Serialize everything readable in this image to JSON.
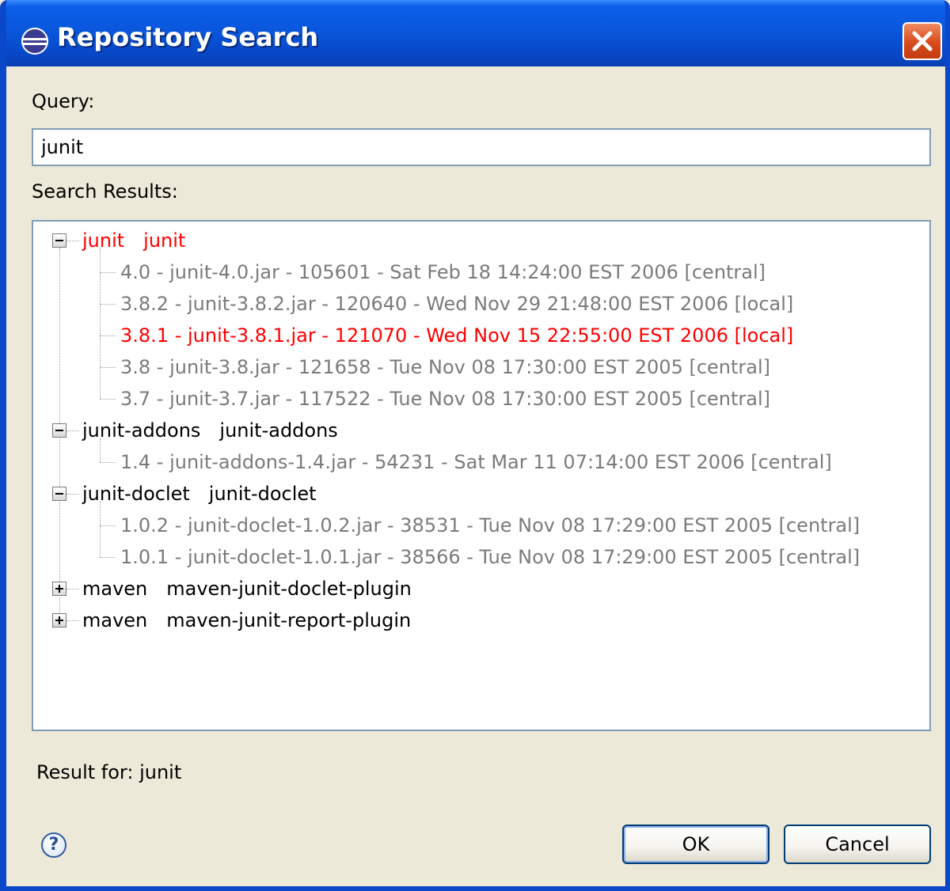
{
  "window": {
    "title": "Repository Search"
  },
  "query": {
    "label": "Query:",
    "value": "junit"
  },
  "results": {
    "label": "Search Results:",
    "groups": [
      {
        "group": "junit",
        "artifact": "junit",
        "expanded": true,
        "highlight": true,
        "items": [
          {
            "text": "4.0 - junit-4.0.jar - 105601 - Sat Feb 18 14:24:00 EST 2006 [central]",
            "highlight": false
          },
          {
            "text": "3.8.2 - junit-3.8.2.jar - 120640 - Wed Nov 29 21:48:00 EST 2006 [local]",
            "highlight": false
          },
          {
            "text": "3.8.1 - junit-3.8.1.jar - 121070 - Wed Nov 15 22:55:00 EST 2006 [local]",
            "highlight": true
          },
          {
            "text": "3.8 - junit-3.8.jar - 121658 - Tue Nov 08 17:30:00 EST 2005 [central]",
            "highlight": false
          },
          {
            "text": "3.7 - junit-3.7.jar - 117522 - Tue Nov 08 17:30:00 EST 2005 [central]",
            "highlight": false
          }
        ]
      },
      {
        "group": "junit-addons",
        "artifact": "junit-addons",
        "expanded": true,
        "highlight": false,
        "items": [
          {
            "text": "1.4 - junit-addons-1.4.jar - 54231 - Sat Mar 11 07:14:00 EST 2006 [central]",
            "highlight": false
          }
        ]
      },
      {
        "group": "junit-doclet",
        "artifact": "junit-doclet",
        "expanded": true,
        "highlight": false,
        "items": [
          {
            "text": "1.0.2 - junit-doclet-1.0.2.jar - 38531 - Tue Nov 08 17:29:00 EST 2005 [central]",
            "highlight": false
          },
          {
            "text": "1.0.1 - junit-doclet-1.0.1.jar - 38566 - Tue Nov 08 17:29:00 EST 2005 [central]",
            "highlight": false
          }
        ]
      },
      {
        "group": "maven",
        "artifact": "maven-junit-doclet-plugin",
        "expanded": false,
        "highlight": false,
        "items": []
      },
      {
        "group": "maven",
        "artifact": "maven-junit-report-plugin",
        "expanded": false,
        "highlight": false,
        "items": []
      }
    ]
  },
  "status": {
    "text": "Result for: junit"
  },
  "buttons": {
    "ok": "OK",
    "cancel": "Cancel",
    "help": "?"
  },
  "colors": {
    "highlight": "#ff0000",
    "version": "#7b7b7b",
    "titlebar": "#0a57dd"
  }
}
